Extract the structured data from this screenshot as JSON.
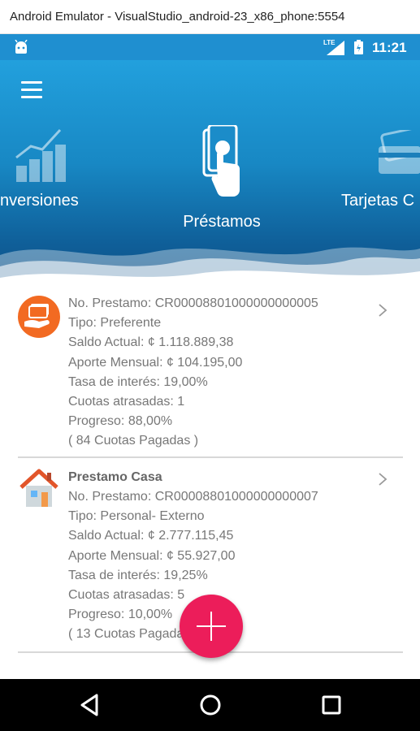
{
  "window": {
    "title": "Android Emulator - VisualStudio_android-23_x86_phone:5554"
  },
  "statusbar": {
    "lte": "LTE",
    "time": "11:21",
    "icons": [
      "android-icon",
      "lte-signal-icon",
      "battery-icon"
    ]
  },
  "header": {
    "menu_icon": "hamburger-menu-icon",
    "categories": [
      {
        "label": "nversiones",
        "icon": "growth-chart-icon"
      },
      {
        "label": "Préstamos",
        "icon": "hand-money-icon"
      },
      {
        "label": "Tarjetas C",
        "icon": "credit-card-icon"
      }
    ],
    "colors": {
      "top": "#22a0dd",
      "bottom": "#0d4f85"
    }
  },
  "loans": [
    {
      "icon": "hand-money-orange-icon",
      "title": "",
      "no_prestamo": "No. Prestamo:  CR00008801000000000005",
      "tipo": "Tipo:  Preferente",
      "saldo": "Saldo Actual:  ¢ 1.118.889,38",
      "aporte": "Aporte Mensual:  ¢ 104.195,00",
      "tasa": "Tasa de interés:  19,00%",
      "cuotas_atrasadas": "Cuotas atrasadas:  1",
      "progreso": "Progreso:  88,00%",
      "cuotas_pagadas": "(  84  Cuotas Pagadas  )"
    },
    {
      "icon": "house-icon",
      "title": "Prestamo Casa",
      "no_prestamo": "No. Prestamo:  CR00008801000000000007",
      "tipo": "Tipo:  Personal- Externo",
      "saldo": "Saldo Actual:  ¢ 2.777.115,45",
      "aporte": "Aporte Mensual:  ¢ 55.927,00",
      "tasa": "Tasa de interés:  19,25%",
      "cuotas_atrasadas": "Cuotas atrasadas:  5",
      "progreso": "Progreso:  10,00%",
      "cuotas_pagadas": "(  13  Cuotas Pagadas  )"
    }
  ],
  "fab": {
    "icon": "plus-icon",
    "color": "#ec1d5a"
  },
  "navbar": {
    "icons": [
      "back-icon",
      "home-icon",
      "recents-icon"
    ]
  }
}
